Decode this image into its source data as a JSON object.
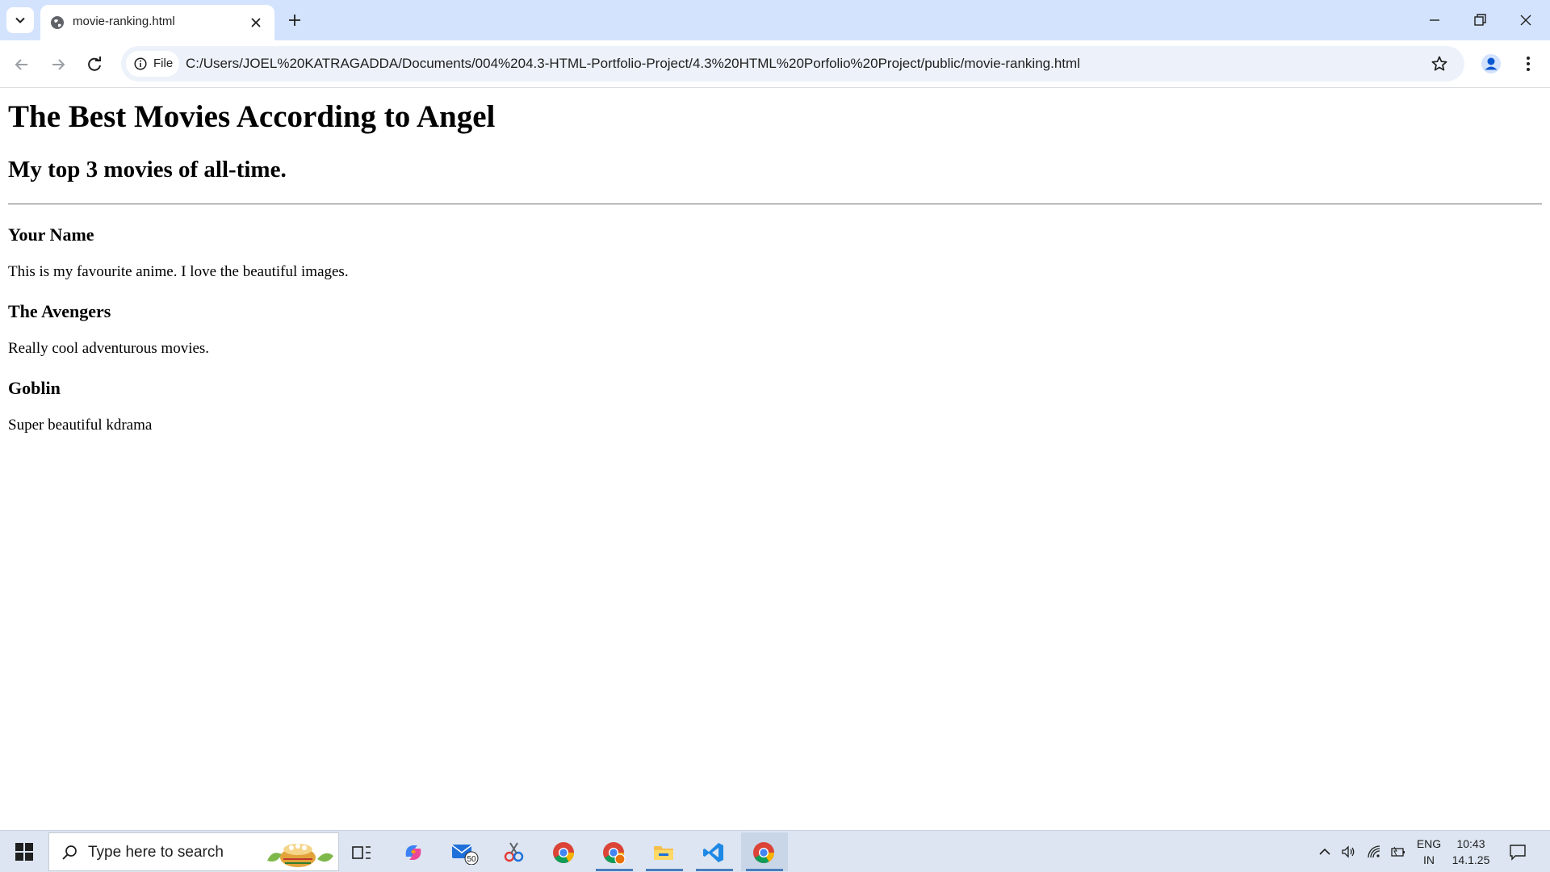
{
  "browser": {
    "tab": {
      "title": "movie-ranking.html"
    },
    "omnibox": {
      "site_chip_label": "File",
      "url": "C:/Users/JOEL%20KATRAGADDA/Documents/004%204.3-HTML-Portfolio-Project/4.3%20HTML%20Porfolio%20Project/public/movie-ranking.html"
    }
  },
  "page": {
    "title": "The Best Movies According to Angel",
    "subtitle": "My top 3 movies of all-time.",
    "movies": [
      {
        "name": "Your Name",
        "description": "This is my favourite anime. I love the beautiful images."
      },
      {
        "name": "The Avengers",
        "description": "Really cool adventurous movies."
      },
      {
        "name": "Goblin",
        "description": "Super beautiful kdrama"
      }
    ]
  },
  "taskbar": {
    "search_placeholder": "Type here to search",
    "mail_badge": "50",
    "tray": {
      "language_line1": "ENG",
      "language_line2": "IN",
      "time": "10:43",
      "date": "14.1.25"
    }
  },
  "colors": {
    "tabstrip_bg": "#d3e3fd",
    "omnibox_bg": "#edf2fa",
    "taskbar_bg": "#dce5f1",
    "active_underline": "#4a7ebb"
  }
}
